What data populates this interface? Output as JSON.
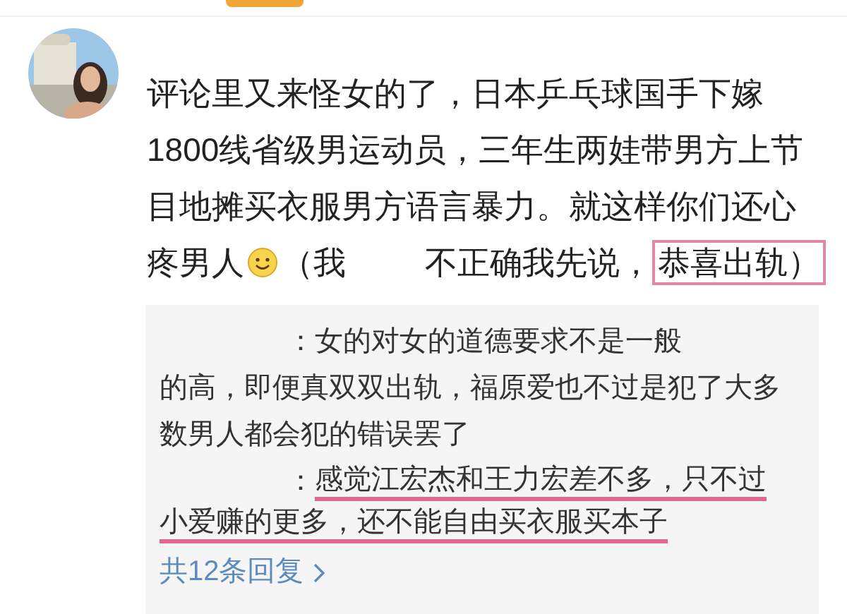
{
  "comment": {
    "lines": [
      [
        {
          "kind": "text",
          "text": "评论里又来怪女的了，日本乒乓球国手下嫁"
        }
      ],
      [
        {
          "kind": "text",
          "text": "1800线省级男运动员，三年生两娃带男方上节"
        }
      ],
      [
        {
          "kind": "text",
          "text": "目地摊买衣服男方语言暴力。就这样你们还心"
        }
      ],
      [
        {
          "kind": "text",
          "text": "疼男人"
        },
        {
          "kind": "emoji"
        },
        {
          "kind": "text",
          "text": "（我"
        },
        {
          "kind": "redacted"
        },
        {
          "kind": "text",
          "text": "不正确我先说，"
        },
        {
          "kind": "highlight",
          "text": "恭喜出轨）"
        }
      ]
    ]
  },
  "replies": [
    {
      "lines": [
        [
          {
            "kind": "redacted"
          },
          {
            "kind": "text",
            "text": "：女的对女的道德要求不是一般"
          }
        ],
        [
          {
            "kind": "text",
            "text": "的高，即便真双双出轨，福原爱也不过是犯了大多"
          }
        ],
        [
          {
            "kind": "text",
            "text": "数男人都会犯的错误罢了"
          }
        ]
      ]
    },
    {
      "lines": [
        [
          {
            "kind": "redacted"
          },
          {
            "kind": "text",
            "text": "："
          },
          {
            "kind": "underline",
            "text": "感觉江宏杰和王力宏差不多，只不过"
          }
        ],
        [
          {
            "kind": "underline",
            "text": "小爱赚的更多，还不能自由买衣服买本子"
          }
        ]
      ]
    }
  ],
  "more_replies": "共12条回复"
}
